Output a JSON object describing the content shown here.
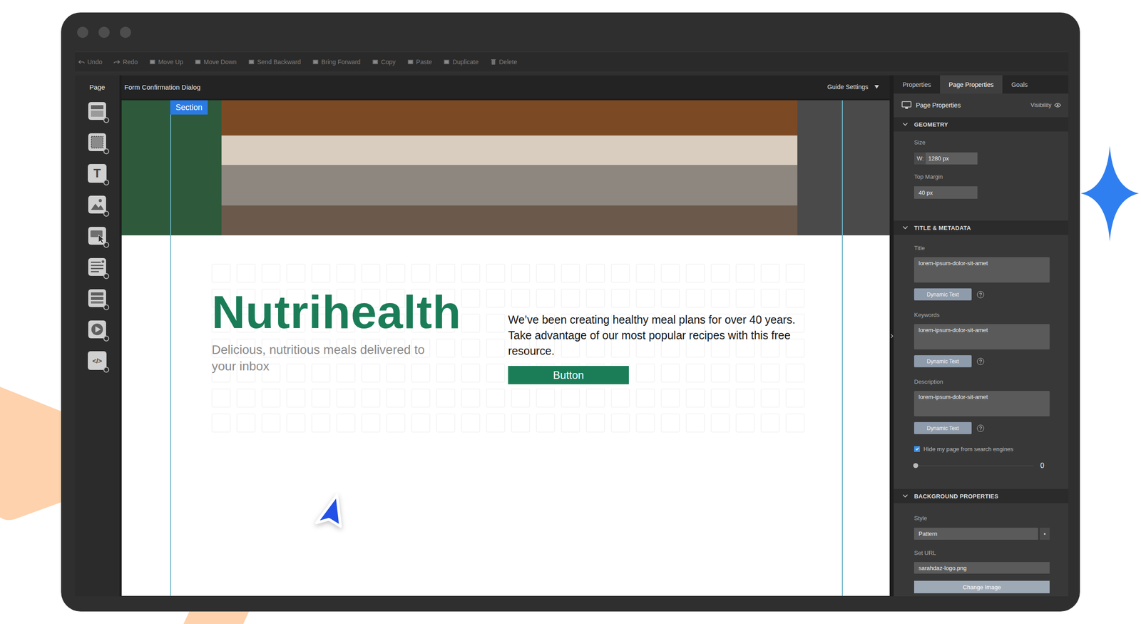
{
  "toolbar": [
    {
      "label": "Undo",
      "kind": "undo"
    },
    {
      "label": "Redo",
      "kind": "redo"
    },
    {
      "label": "Move Up",
      "kind": "box"
    },
    {
      "label": "Move Down",
      "kind": "box"
    },
    {
      "label": "Send Backward",
      "kind": "box"
    },
    {
      "label": "Bring Forward",
      "kind": "box"
    },
    {
      "label": "Copy",
      "kind": "box"
    },
    {
      "label": "Paste",
      "kind": "box"
    },
    {
      "label": "Duplicate",
      "kind": "box"
    },
    {
      "label": "Delete",
      "kind": "trash"
    }
  ],
  "tools_panel": {
    "title": "Page",
    "tools": [
      {
        "kind": "section"
      },
      {
        "kind": "container"
      },
      {
        "kind": "text",
        "glyph": "T"
      },
      {
        "kind": "image"
      },
      {
        "kind": "button"
      },
      {
        "kind": "form"
      },
      {
        "kind": "list"
      },
      {
        "kind": "video"
      },
      {
        "kind": "code",
        "glyph": "</>"
      }
    ]
  },
  "canvas": {
    "title": "Form Confirmation Dialog",
    "guide_settings": "Guide Settings",
    "section_badge": "Section",
    "brand": "Nutrihealth",
    "tagline": "Delicious, nutritious meals delivered to your inbox",
    "body": "We’ve been creating healthy meal plans for over 40 years. Take advantage of our most popular recipes with this free resource.",
    "button": "Button"
  },
  "panel": {
    "tabs": [
      {
        "label": "Properties",
        "selected": false
      },
      {
        "label": "Page Properties",
        "selected": true
      },
      {
        "label": "Goals",
        "selected": false
      }
    ],
    "header": {
      "title": "Page Properties",
      "visibility": "Visibility"
    },
    "geometry": {
      "title": "GEOMETRY",
      "expanded": true,
      "size_label": "Size",
      "width_label": "W:",
      "width": "1280 px",
      "top_margin_label": "Top Margin",
      "top_margin": "40 px"
    },
    "metadata": {
      "title": "TITLE & METADATA",
      "expanded": true,
      "fields": [
        {
          "label": "Title",
          "value": "lorem-ipsum-dolor-sit-amet",
          "button": "Dynamic Text",
          "help": "?"
        },
        {
          "label": "Keywords",
          "value": "lorem-ipsum-dolor-sit-amet",
          "button": "Dynamic Text",
          "help": "?"
        },
        {
          "label": "Description",
          "value": "lorem-ipsum-dolor-sit-amet",
          "button": "Dynamic Text",
          "help": "?"
        }
      ],
      "hide_search": {
        "label": "Hide my page from search engines",
        "checked": true
      },
      "slider": {
        "level": 0,
        "reading": "0"
      }
    },
    "background": {
      "title": "BACKGROUND PROPERTIES",
      "expanded": true,
      "style_label": "Style",
      "style": "Pattern",
      "url_label": "Set URL",
      "url": "sarahdaz-logo.png",
      "button": "Change Image"
    }
  }
}
